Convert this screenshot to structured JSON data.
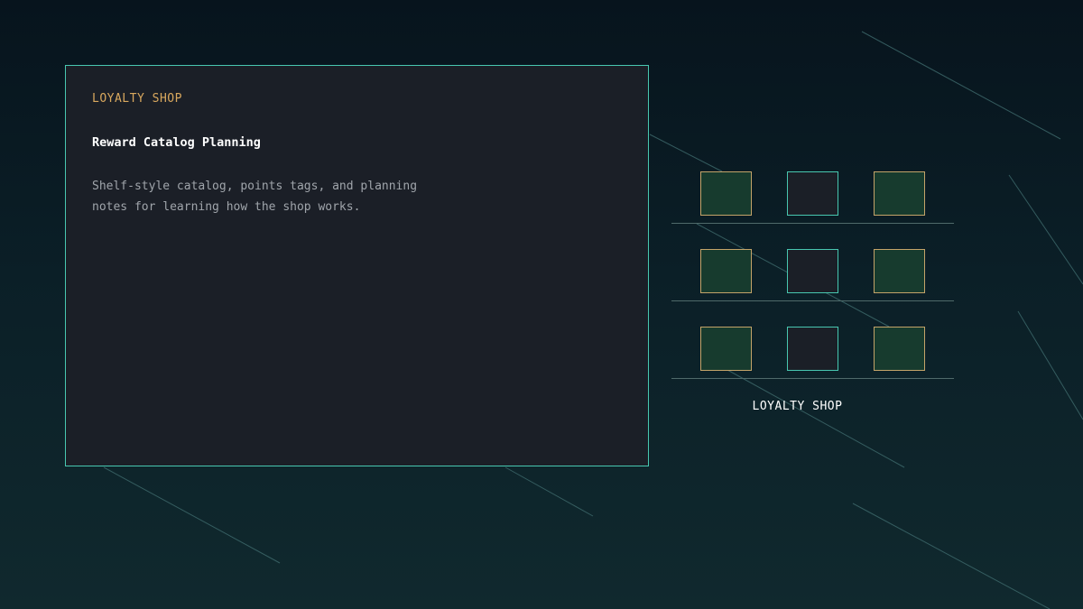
{
  "panel": {
    "eyebrow": "LOYALTY SHOP",
    "title": "Reward Catalog Planning",
    "description_lines": [
      "Shelf-style catalog, points tags, and planning",
      "notes for learning how the shop works."
    ]
  },
  "shelf": {
    "label": "LOYALTY SHOP",
    "rows": [
      {
        "items": [
          "gold",
          "teal",
          "gold"
        ]
      },
      {
        "items": [
          "gold",
          "teal",
          "gold"
        ]
      },
      {
        "items": [
          "gold",
          "teal",
          "gold"
        ]
      }
    ]
  },
  "colors": {
    "background_top": "#07141d",
    "background_bottom": "#10292e",
    "panel_background": "#1b1f27",
    "accent_teal": "#48c7b0",
    "accent_gold": "#d9a85e",
    "item_fill": "#173b2e"
  }
}
